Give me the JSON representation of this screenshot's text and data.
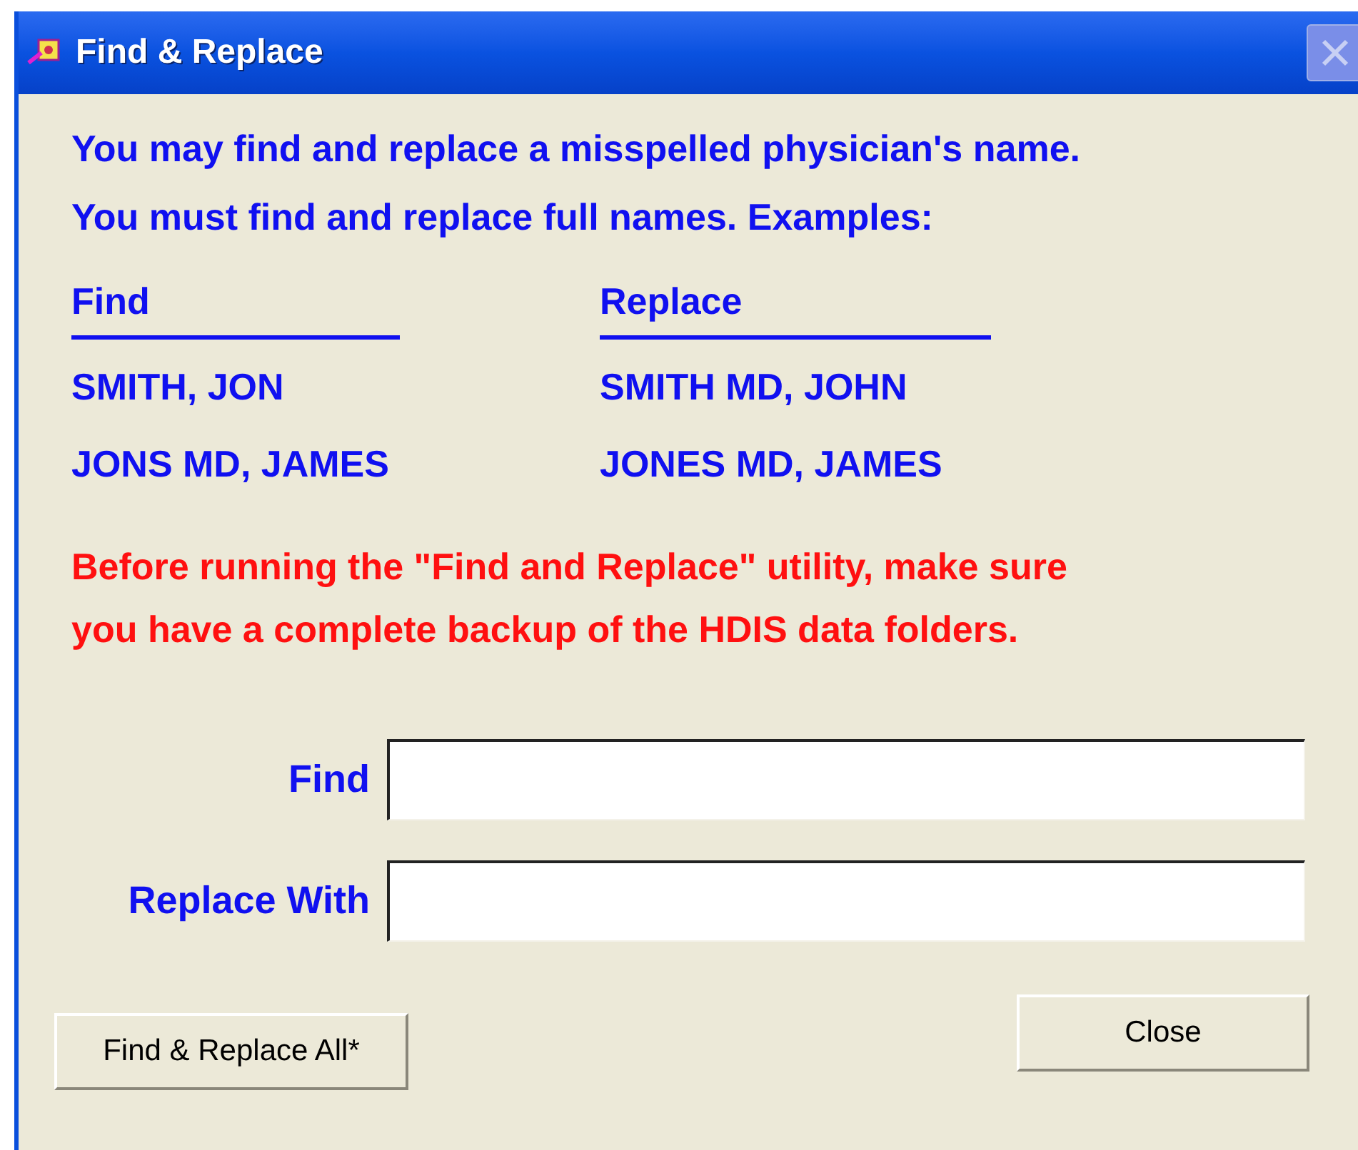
{
  "window": {
    "title": "Find & Replace"
  },
  "intro": [
    "You may find and replace a misspelled physician's name.",
    "You must find and replace full names.  Examples:"
  ],
  "examples": {
    "columns": [
      "Find",
      "Replace"
    ],
    "rows": [
      [
        "SMITH, JON",
        "SMITH MD, JOHN"
      ],
      [
        "JONS MD, JAMES",
        "JONES MD, JAMES"
      ]
    ]
  },
  "warning": [
    "Before running the \"Find and Replace\" utility, make sure",
    "you have a complete backup of the HDIS data folders."
  ],
  "fields": [
    {
      "label": "Find"
    },
    {
      "label": "Replace With"
    }
  ],
  "buttons": {
    "replace_all": "Find & Replace All*",
    "close": "Close"
  }
}
